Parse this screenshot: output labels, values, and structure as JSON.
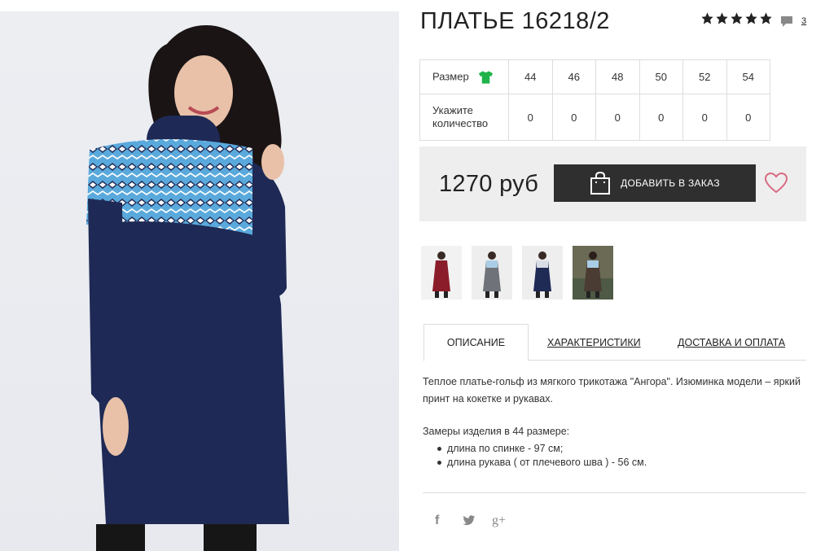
{
  "product": {
    "title": "ПЛАТЬЕ 16218/2",
    "rating_stars": 5,
    "review_count": "3",
    "photo_alt": "dress-photo"
  },
  "sizes": {
    "row1_label": "Размер",
    "row2_label": "Укажите количество",
    "values": [
      "44",
      "46",
      "48",
      "50",
      "52",
      "54"
    ],
    "quantities": [
      "0",
      "0",
      "0",
      "0",
      "0",
      "0"
    ]
  },
  "purchase": {
    "price": "1270 руб",
    "add_button": "ДОБАВИТЬ В ЗАКАЗ"
  },
  "thumbnails": [
    {
      "color": "#8b1d2a"
    },
    {
      "color": "#6f7278"
    },
    {
      "color": "#1f2a55"
    },
    {
      "color": "#4a3b33"
    }
  ],
  "tabs": {
    "description": "ОПИСАНИЕ",
    "characteristics": "ХАРАКТЕРИСТИКИ",
    "delivery": "ДОСТАВКА И ОПЛАТА"
  },
  "description": {
    "text": "Теплое платье-гольф из мягкого трикотажа \"Ангора\". Изюминка модели – яркий принт на кокетке и рукавах.",
    "measure_title": "Замеры изделия в 44 размере:",
    "measures": [
      "длина по спинке - 97 см;",
      "длина рукава ( от плечевого шва ) - 56 см."
    ]
  },
  "social": {
    "facebook": "f",
    "twitter": "twitter-icon",
    "google": "g+"
  },
  "colors": {
    "dress_navy": "#1e2a55",
    "pattern_blue": "#5aa9dc",
    "button_dark": "#2f2f2f",
    "heart_pink": "#d96b82",
    "shirt_green": "#1fb34a"
  }
}
